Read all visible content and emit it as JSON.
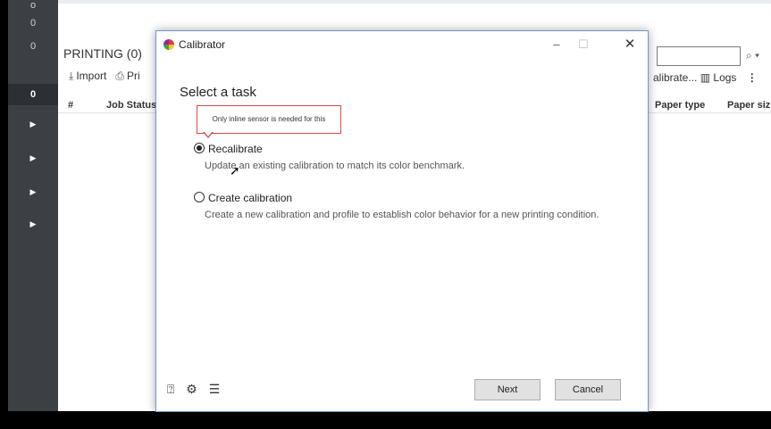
{
  "rail": {
    "counts": [
      "0",
      "0",
      "0",
      "0"
    ],
    "active_count": "0",
    "arrow_glyph": "▶"
  },
  "background": {
    "printing_title": "PRINTING (0)",
    "toolbar": {
      "import_label": "Import",
      "print_label": "Pri"
    },
    "columns": {
      "index": "#",
      "job_status": "Job Status",
      "paper_type": "Paper type",
      "paper_size": "Paper siz"
    },
    "right_tools": {
      "calibrate_label": "alibrate...",
      "logs_label": "Logs"
    },
    "search_icon": "search-icon"
  },
  "dialog": {
    "title": "Calibrator",
    "heading": "Select a task",
    "tooltip": "Only inline sensor is needed for this",
    "options": [
      {
        "label": "Recalibrate",
        "description": "Update an existing calibration to match its color benchmark.",
        "selected": true
      },
      {
        "label": "Create calibration",
        "description": "Create a new calibration and profile to establish color behavior for a new printing condition.",
        "selected": false
      }
    ],
    "buttons": {
      "next": "Next",
      "cancel": "Cancel"
    },
    "footer_icons": [
      "help-icon",
      "gear-icon",
      "list-icon"
    ]
  }
}
